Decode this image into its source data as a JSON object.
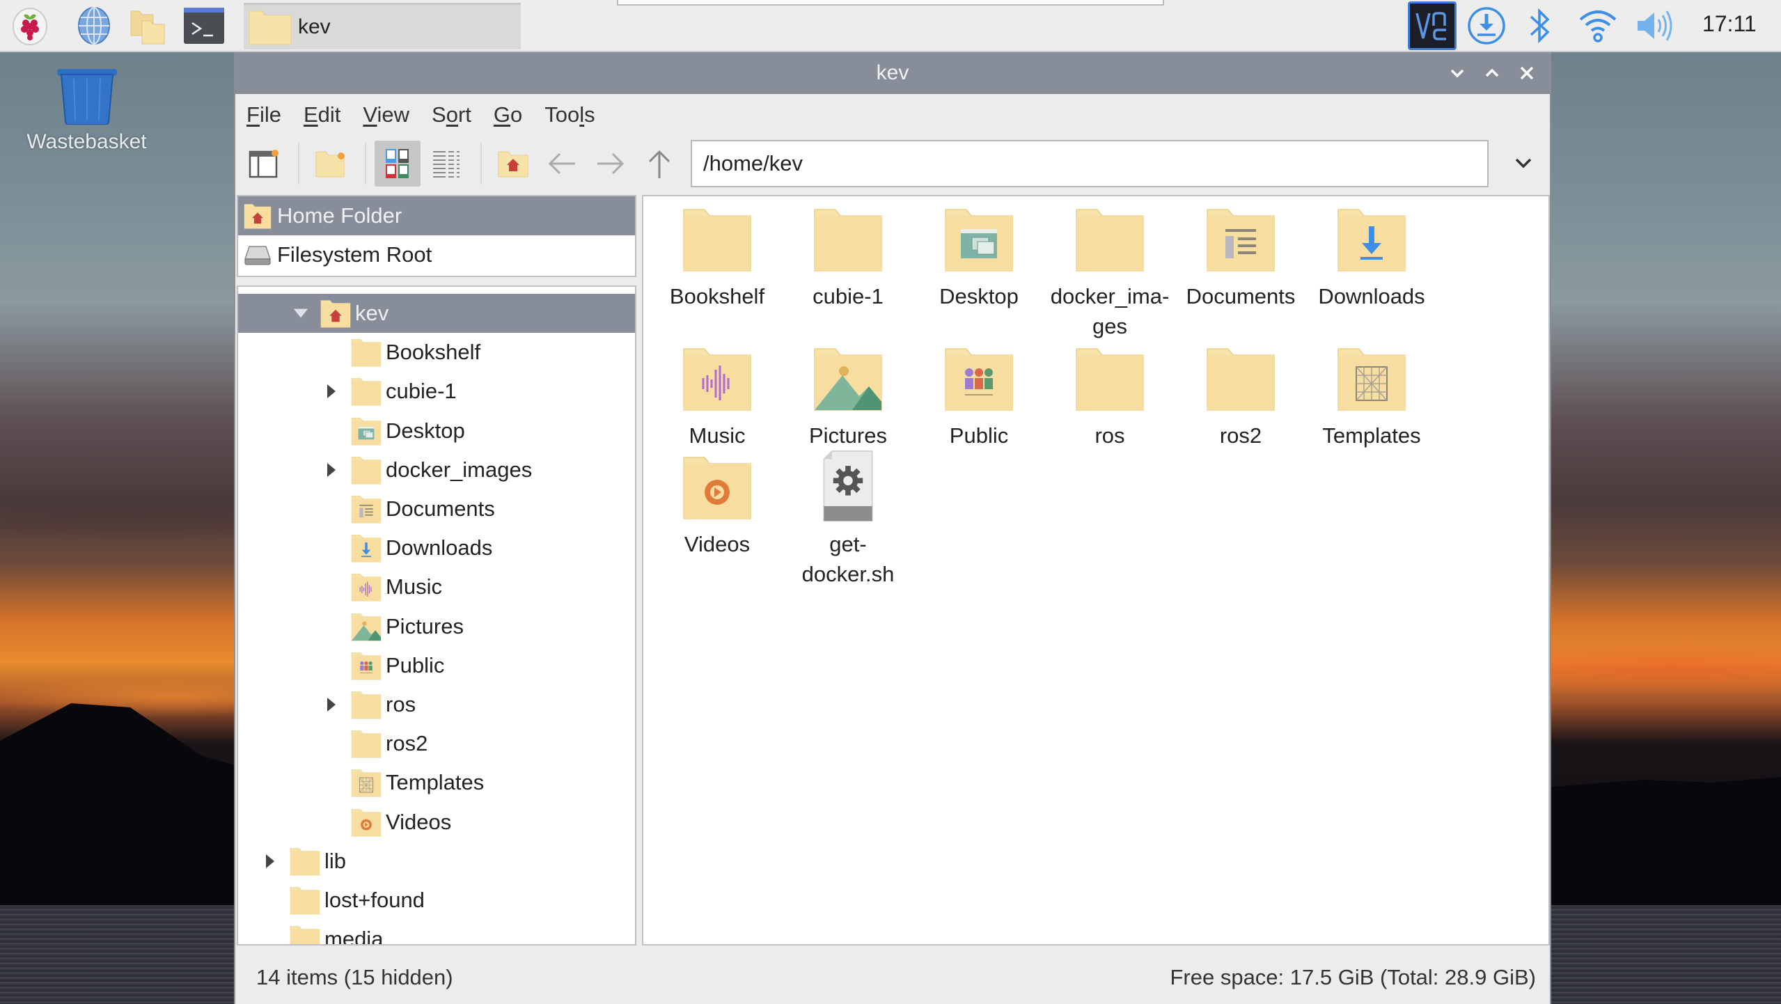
{
  "taskbar": {
    "launchers": [
      {
        "name": "raspberry-menu",
        "icon": "raspberry-pi-icon"
      },
      {
        "name": "web-browser",
        "icon": "globe-icon"
      },
      {
        "name": "file-manager",
        "icon": "folders-icon"
      },
      {
        "name": "terminal",
        "icon": "terminal-icon"
      }
    ],
    "window_button_label": "kev",
    "tray": [
      {
        "name": "vnc",
        "icon": "vnc-icon",
        "label": "VNC"
      },
      {
        "name": "updates",
        "icon": "download-icon"
      },
      {
        "name": "bluetooth",
        "icon": "bluetooth-icon"
      },
      {
        "name": "wifi",
        "icon": "wifi-icon"
      },
      {
        "name": "volume",
        "icon": "volume-icon"
      }
    ],
    "clock": "17:11"
  },
  "desktop": {
    "icons": [
      {
        "label": "Wastebasket",
        "icon": "trash-icon"
      }
    ]
  },
  "window": {
    "title": "kev",
    "controls": [
      "minimize",
      "maximize",
      "close"
    ],
    "menu": [
      {
        "label": "File",
        "mnemonic": "F"
      },
      {
        "label": "Edit",
        "mnemonic": "E"
      },
      {
        "label": "View",
        "mnemonic": "V"
      },
      {
        "label": "Sort",
        "mnemonic": "o"
      },
      {
        "label": "Go",
        "mnemonic": "G"
      },
      {
        "label": "Tools",
        "mnemonic": "l"
      }
    ],
    "toolbar": {
      "buttons": [
        "new-window",
        "new-folder",
        "icon-view",
        "list-view",
        "home",
        "back",
        "forward",
        "up"
      ],
      "active_view": "icon-view",
      "path": "/home/kev"
    },
    "places": [
      {
        "label": "Home Folder",
        "icon": "home-folder-icon",
        "selected": true
      },
      {
        "label": "Filesystem Root",
        "icon": "drive-icon",
        "selected": false
      }
    ],
    "tree": [
      {
        "label": "kev",
        "depth": 1,
        "expander": "expanded",
        "icon": "home",
        "selected": true
      },
      {
        "label": "Bookshelf",
        "depth": 2,
        "expander": "none",
        "icon": "folder"
      },
      {
        "label": "cubie-1",
        "depth": 2,
        "expander": "collapsed",
        "icon": "folder"
      },
      {
        "label": "Desktop",
        "depth": 2,
        "expander": "none",
        "icon": "desktop"
      },
      {
        "label": "docker_images",
        "depth": 2,
        "expander": "collapsed",
        "icon": "folder"
      },
      {
        "label": "Documents",
        "depth": 2,
        "expander": "none",
        "icon": "documents"
      },
      {
        "label": "Downloads",
        "depth": 2,
        "expander": "none",
        "icon": "downloads"
      },
      {
        "label": "Music",
        "depth": 2,
        "expander": "none",
        "icon": "music"
      },
      {
        "label": "Pictures",
        "depth": 2,
        "expander": "none",
        "icon": "pictures"
      },
      {
        "label": "Public",
        "depth": 2,
        "expander": "none",
        "icon": "public"
      },
      {
        "label": "ros",
        "depth": 2,
        "expander": "collapsed",
        "icon": "folder"
      },
      {
        "label": "ros2",
        "depth": 2,
        "expander": "none",
        "icon": "folder"
      },
      {
        "label": "Templates",
        "depth": 2,
        "expander": "none",
        "icon": "templates"
      },
      {
        "label": "Videos",
        "depth": 2,
        "expander": "none",
        "icon": "videos"
      },
      {
        "label": "lib",
        "depth": 0,
        "expander": "collapsed",
        "icon": "folder"
      },
      {
        "label": "lost+found",
        "depth": 0,
        "expander": "none",
        "icon": "folder"
      },
      {
        "label": "media",
        "depth": 0,
        "expander": "none",
        "icon": "folder"
      }
    ],
    "files": [
      {
        "name": "Bookshelf",
        "icon": "folder"
      },
      {
        "name": "cubie-1",
        "icon": "folder"
      },
      {
        "name": "Desktop",
        "icon": "desktop"
      },
      {
        "name": "docker_ima-\nges",
        "icon": "folder"
      },
      {
        "name": "Documents",
        "icon": "documents"
      },
      {
        "name": "Downloads",
        "icon": "downloads"
      },
      {
        "name": "Music",
        "icon": "music"
      },
      {
        "name": "Pictures",
        "icon": "pictures"
      },
      {
        "name": "Public",
        "icon": "public"
      },
      {
        "name": "ros",
        "icon": "folder"
      },
      {
        "name": "ros2",
        "icon": "folder"
      },
      {
        "name": "Templates",
        "icon": "templates"
      },
      {
        "name": "Videos",
        "icon": "videos"
      },
      {
        "name": "get-\ndocker.sh",
        "icon": "script"
      }
    ],
    "status": {
      "items": "14 items (15 hidden)",
      "free_space": "Free space: 17.5 GiB (Total: 28.9 GiB)"
    }
  },
  "colors": {
    "folder": "#f7dfa0",
    "folder_dark": "#e8c97a",
    "selection": "#878e99",
    "titlebar": "#878e99",
    "accent_blue": "#3d8ee6",
    "home_red": "#c6413b"
  }
}
